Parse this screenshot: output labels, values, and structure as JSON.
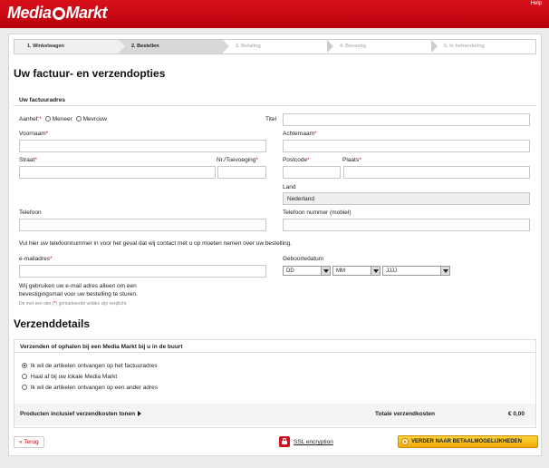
{
  "header": {
    "logo": "Media Markt",
    "help": "Help"
  },
  "steps": [
    {
      "label": "1. Winkelwagen",
      "state": "done"
    },
    {
      "label": "2. Bestellen",
      "state": "active"
    },
    {
      "label": "3. Betaling",
      "state": "todo"
    },
    {
      "label": "4. Bevestig",
      "state": "todo"
    },
    {
      "label": "5. In behandeling",
      "state": "todo"
    }
  ],
  "page_title": "Uw factuur- en verzendopties",
  "billing": {
    "heading": "Uw factuuradres",
    "salutation_label": "Aanhef:",
    "salutation_options": [
      "Meneer",
      "Mevrouw"
    ],
    "title_label": "Titel",
    "firstname_label": "Voornaam",
    "lastname_label": "Achternaam",
    "street_label": "Straat",
    "housenr_label": "Nr./Toevoeging",
    "postcode_label": "Postcode",
    "city_label": "Plaats",
    "country_label": "Land",
    "country_value": "Nederland",
    "phone_label": "Telefoon",
    "mobile_label": "Telefoon nummer (mobiel)",
    "phone_note": "Vul hier uw telefoonnummer in voor het geval dat wij contact met u op moeten nemen over uw bestelling.",
    "email_label": "e-mailadres",
    "birthdate_label": "Geboortedatum",
    "birth_day": "DD",
    "birth_month": "MM",
    "birth_year": "JJJJ",
    "email_note_line1": "Wij gebruiken uw e-mail adres alleen om een",
    "email_note_line2": "bevestigingsmail voor uw bestelling te sturen.",
    "required_note_pre": "De met een ster (",
    "required_star": "*",
    "required_note_post": ") gemarkeerde velden zijn verplicht"
  },
  "shipping": {
    "title": "Verzenddetails",
    "heading": "Verzenden of ophalen bij een Media Markt bij u in de buurt",
    "options": [
      "Ik wil de artikelen ontvangen op het factuuradres",
      "Haal af bij uw lokale Media Markt",
      "Ik wil de artikelen ontvangen op een ander adres"
    ],
    "selected": 0,
    "products_toggle": "Producten inclusief verzendkosten tonen",
    "total_label": "Totale verzendkosten",
    "total_value": "€ 0,00"
  },
  "footer": {
    "back": "« Terug",
    "ssl": "SSL encryption",
    "next": "VERDER NAAR BETAALMOGELIJKHEDEN"
  },
  "colors": {
    "brand_red": "#c40612",
    "accent_yellow": "#f7c21b"
  }
}
